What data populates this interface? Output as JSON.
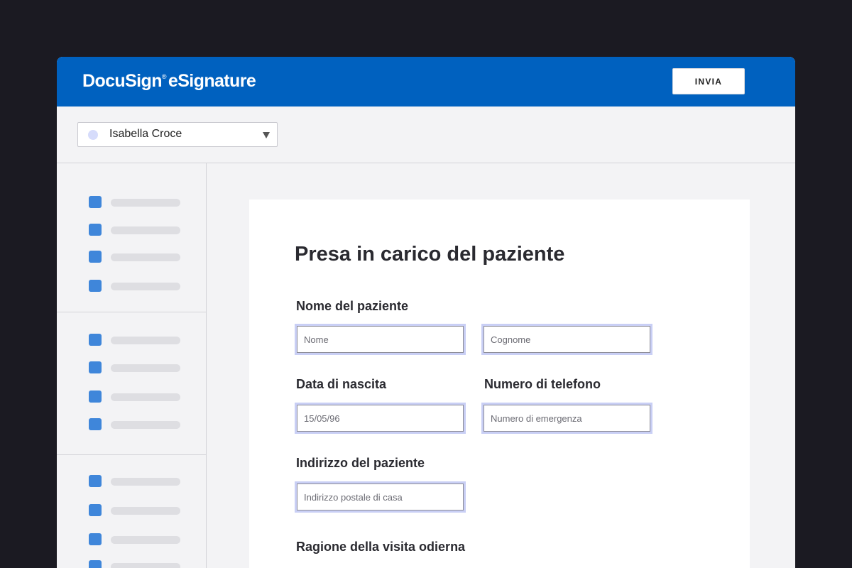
{
  "header": {
    "brand_name": "DocuSign",
    "brand_product": "eSignature",
    "send_label": "INVIA"
  },
  "recipient": {
    "selected_name": "Isabella Croce"
  },
  "form": {
    "title": "Presa in carico del paziente",
    "patient_name": {
      "label": "Nome del paziente",
      "first_placeholder": "Nome",
      "last_placeholder": "Cognome"
    },
    "birth_date": {
      "label": "Data di nascita",
      "value": "15/05/96"
    },
    "phone": {
      "label": "Numero di telefono",
      "placeholder": "Numero di emergenza"
    },
    "address": {
      "label": "Indirizzo del paziente",
      "placeholder": "Indirizzo postale di casa"
    },
    "visit_reason": {
      "label": "Ragione della visita odierna"
    }
  },
  "colors": {
    "brand_blue": "#0061bf",
    "field_square": "#3f86da",
    "recipient_dot": "#d6dcfb"
  }
}
